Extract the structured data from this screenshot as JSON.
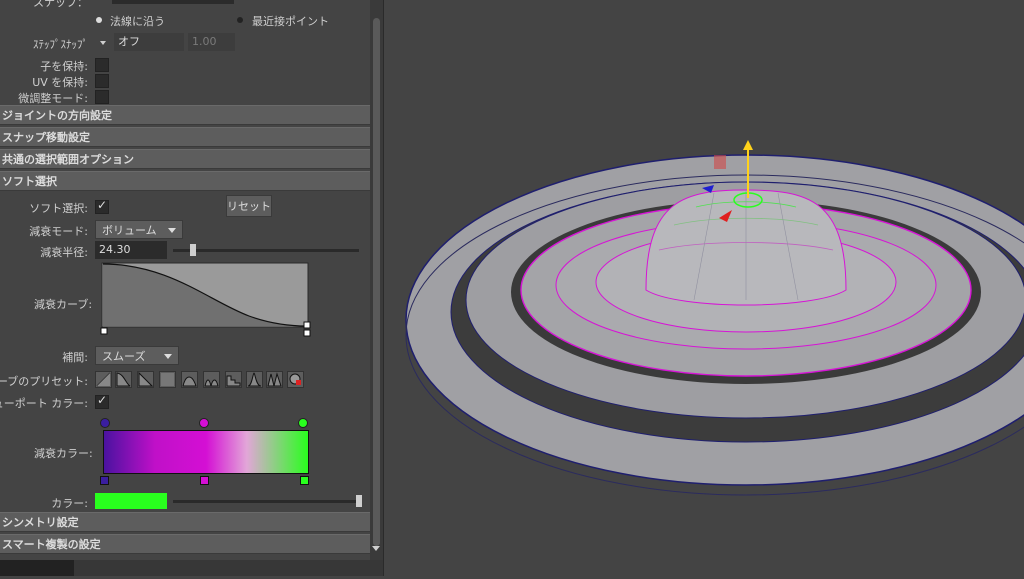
{
  "panel": {
    "partial_top_label": "スナップ：",
    "radio_surface_normal": "法線に沿う",
    "radio_closest_point": "最近接ポイント",
    "step_snap_label": "ｽﾃｯﾌﾟｽﾅｯﾌﾟ",
    "step_snap_value": "オフ",
    "step_snap_number": "1.00",
    "preserve_children_label": "子を保持:",
    "preserve_uv_label": "UV を保持:",
    "tweak_mode_label": "微調整モード:",
    "sections": {
      "joint_orientation": "ジョイントの方向設定",
      "snap_move": "スナップ移動設定",
      "common_selection": "共通の選択範囲オプション",
      "soft_select": "ソフト選択",
      "symmetry": "シンメトリ設定",
      "smart_duplicate": "スマート複製の設定"
    },
    "soft_select_label": "ソフト選択:",
    "reset_button": "リセット",
    "falloff_mode_label": "減衰モード:",
    "falloff_mode_value": "ボリューム",
    "falloff_radius_label": "減衰半径:",
    "falloff_radius_value": "24.30",
    "falloff_curve_label": "減衰カーブ:",
    "interpolation_label": "補間:",
    "interpolation_value": "スムーズ",
    "curve_presets_label": "カーブのプリセット:",
    "viewport_color_label": "ビューポート カラー:",
    "falloff_color_label": "減衰カラー:",
    "color_label": "カラー:"
  },
  "colors": {
    "accent_green": "#29ff1e",
    "magenta": "#d40fd4",
    "purple": "#4a12a0"
  },
  "state": {
    "soft_select_enabled": true,
    "viewport_color_enabled": true,
    "falloff_radius_slider": 0.2,
    "color_slider": 1.0
  }
}
